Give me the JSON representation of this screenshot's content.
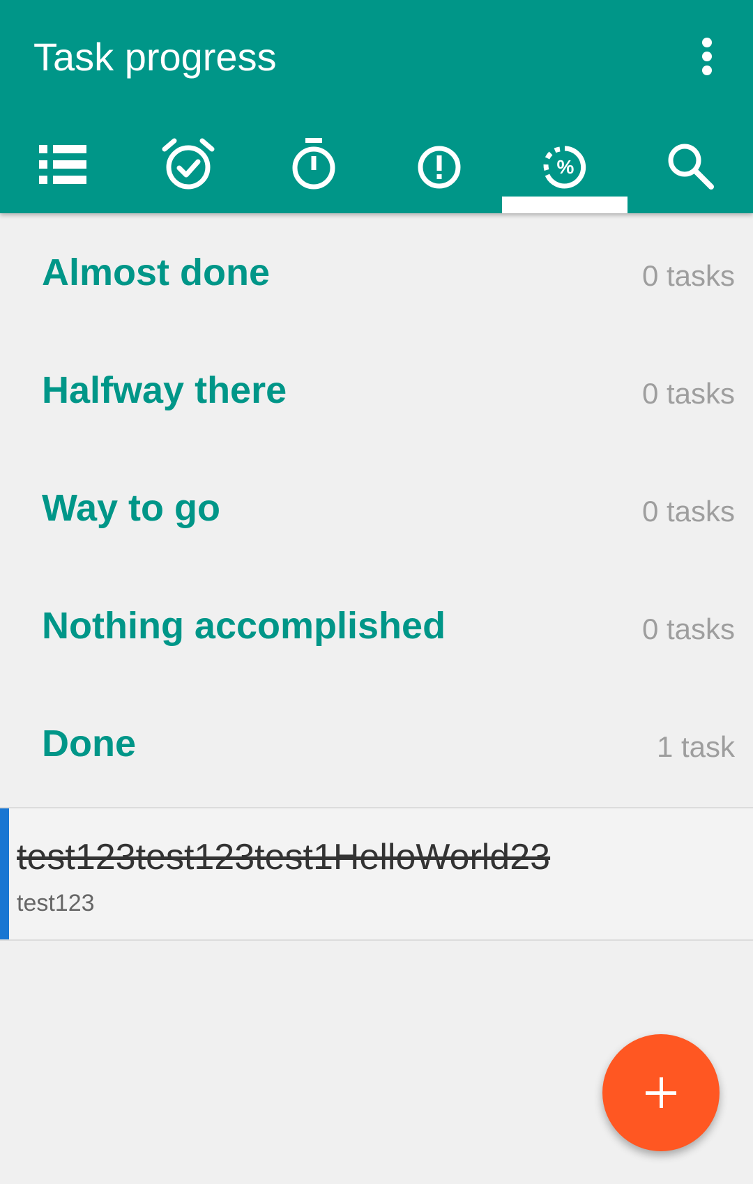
{
  "appbar": {
    "title": "Task progress",
    "overflow_icon": "more-vert-icon",
    "color": "#009688"
  },
  "tabs": [
    {
      "icon": "list-icon",
      "selected": false
    },
    {
      "icon": "alarm-check-icon",
      "selected": false
    },
    {
      "icon": "stopwatch-icon",
      "selected": false
    },
    {
      "icon": "priority-alert-icon",
      "selected": false
    },
    {
      "icon": "progress-percent-icon",
      "selected": true
    },
    {
      "icon": "search-icon",
      "selected": false
    }
  ],
  "sections": [
    {
      "title": "Almost done",
      "count": "0 tasks"
    },
    {
      "title": "Halfway there",
      "count": "0 tasks"
    },
    {
      "title": "Way to go",
      "count": "0 tasks"
    },
    {
      "title": "Nothing accomplished",
      "count": "0 tasks"
    },
    {
      "title": "Done",
      "count": "1 task"
    }
  ],
  "task": {
    "title": "test123test123test1HelloWorld23",
    "subtitle": "test123",
    "completed": true,
    "accent_color": "#1976d2"
  },
  "fab": {
    "icon": "plus-icon",
    "color": "#ff5722"
  }
}
